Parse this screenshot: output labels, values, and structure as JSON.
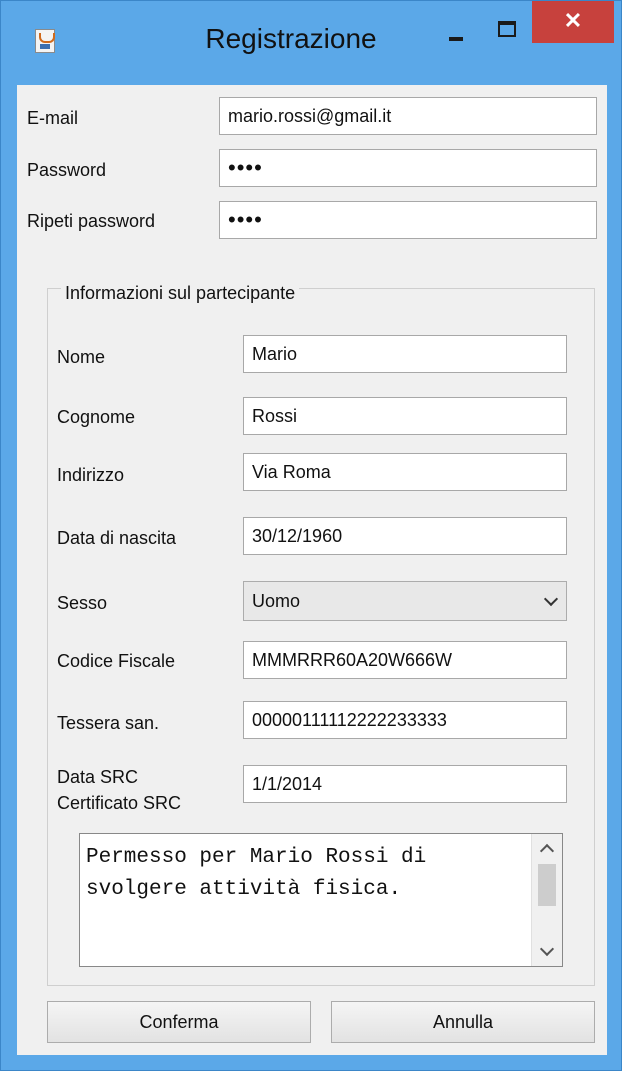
{
  "window": {
    "title": "Registrazione",
    "close_glyph": "✕",
    "icons": {
      "app": "java-cup-icon",
      "minimize": "minimize-icon",
      "maximize": "maximize-icon",
      "close": "close-icon"
    }
  },
  "account": {
    "email_label": "E-mail",
    "email_value": "mario.rossi@gmail.it",
    "password_label": "Password",
    "password_value": "••••",
    "repeat_label": "Ripeti password",
    "repeat_value": "••••"
  },
  "participant": {
    "legend": "Informazioni sul partecipante",
    "nome_label": "Nome",
    "nome_value": "Mario",
    "cognome_label": "Cognome",
    "cognome_value": "Rossi",
    "indirizzo_label": "Indirizzo",
    "indirizzo_value": "Via Roma",
    "nascita_label": "Data di nascita",
    "nascita_value": "30/12/1960",
    "sesso_label": "Sesso",
    "sesso_value": "Uomo",
    "cf_label": "Codice Fiscale",
    "cf_value": "MMMRRR60A20W666W",
    "tessera_label": "Tessera san.",
    "tessera_value": "00000111112222233333",
    "src_label_1": "Data SRC",
    "src_label_2": "Certificato SRC",
    "src_value": "1/1/2014",
    "certificato_text": "Permesso per Mario Rossi di svolgere attività fisica."
  },
  "buttons": {
    "confirm": "Conferma",
    "cancel": "Annulla"
  }
}
